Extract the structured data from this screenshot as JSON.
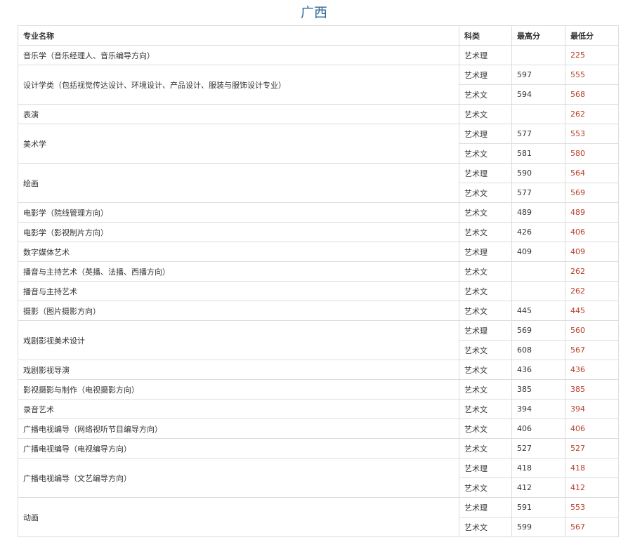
{
  "title": "广西",
  "headers": [
    "专业名称",
    "科类",
    "最高分",
    "最低分"
  ],
  "rows": [
    {
      "major": "音乐学（音乐经理人、音乐编导方向）",
      "entries": [
        {
          "category": "艺术理",
          "max": "",
          "min": "225"
        }
      ]
    },
    {
      "major": "设计学类（包括视觉传达设计、环境设计、产品设计、服装与服饰设计专业）",
      "entries": [
        {
          "category": "艺术理",
          "max": "597",
          "min": "555"
        },
        {
          "category": "艺术文",
          "max": "594",
          "min": "568"
        }
      ]
    },
    {
      "major": "表演",
      "entries": [
        {
          "category": "艺术文",
          "max": "",
          "min": "262"
        }
      ]
    },
    {
      "major": "美术学",
      "entries": [
        {
          "category": "艺术理",
          "max": "577",
          "min": "553"
        },
        {
          "category": "艺术文",
          "max": "581",
          "min": "580"
        }
      ]
    },
    {
      "major": "绘画",
      "entries": [
        {
          "category": "艺术理",
          "max": "590",
          "min": "564"
        },
        {
          "category": "艺术文",
          "max": "577",
          "min": "569"
        }
      ]
    },
    {
      "major": "电影学（院线管理方向）",
      "entries": [
        {
          "category": "艺术文",
          "max": "489",
          "min": "489"
        }
      ]
    },
    {
      "major": "电影学（影视制片方向）",
      "entries": [
        {
          "category": "艺术文",
          "max": "426",
          "min": "406"
        }
      ]
    },
    {
      "major": "数字媒体艺术",
      "entries": [
        {
          "category": "艺术理",
          "max": "409",
          "min": "409"
        }
      ]
    },
    {
      "major": "播音与主持艺术（英播、法播、西播方向）",
      "entries": [
        {
          "category": "艺术文",
          "max": "",
          "min": "262"
        }
      ]
    },
    {
      "major": "播音与主持艺术",
      "entries": [
        {
          "category": "艺术文",
          "max": "",
          "min": "262"
        }
      ]
    },
    {
      "major": "摄影（图片摄影方向）",
      "entries": [
        {
          "category": "艺术文",
          "max": "445",
          "min": "445"
        }
      ]
    },
    {
      "major": "戏剧影视美术设计",
      "entries": [
        {
          "category": "艺术理",
          "max": "569",
          "min": "560"
        },
        {
          "category": "艺术文",
          "max": "608",
          "min": "567"
        }
      ]
    },
    {
      "major": "戏剧影视导演",
      "entries": [
        {
          "category": "艺术文",
          "max": "436",
          "min": "436"
        }
      ]
    },
    {
      "major": "影视摄影与制作（电视摄影方向）",
      "entries": [
        {
          "category": "艺术文",
          "max": "385",
          "min": "385"
        }
      ]
    },
    {
      "major": "录音艺术",
      "entries": [
        {
          "category": "艺术文",
          "max": "394",
          "min": "394"
        }
      ]
    },
    {
      "major": "广播电视编导（网络视听节目编导方向）",
      "entries": [
        {
          "category": "艺术文",
          "max": "406",
          "min": "406"
        }
      ]
    },
    {
      "major": "广播电视编导（电视编导方向）",
      "entries": [
        {
          "category": "艺术文",
          "max": "527",
          "min": "527"
        }
      ]
    },
    {
      "major": "广播电视编导（文艺编导方向）",
      "entries": [
        {
          "category": "艺术理",
          "max": "418",
          "min": "418"
        },
        {
          "category": "艺术文",
          "max": "412",
          "min": "412"
        }
      ]
    },
    {
      "major": "动画",
      "entries": [
        {
          "category": "艺术理",
          "max": "591",
          "min": "553"
        },
        {
          "category": "艺术文",
          "max": "599",
          "min": "567"
        }
      ]
    }
  ]
}
